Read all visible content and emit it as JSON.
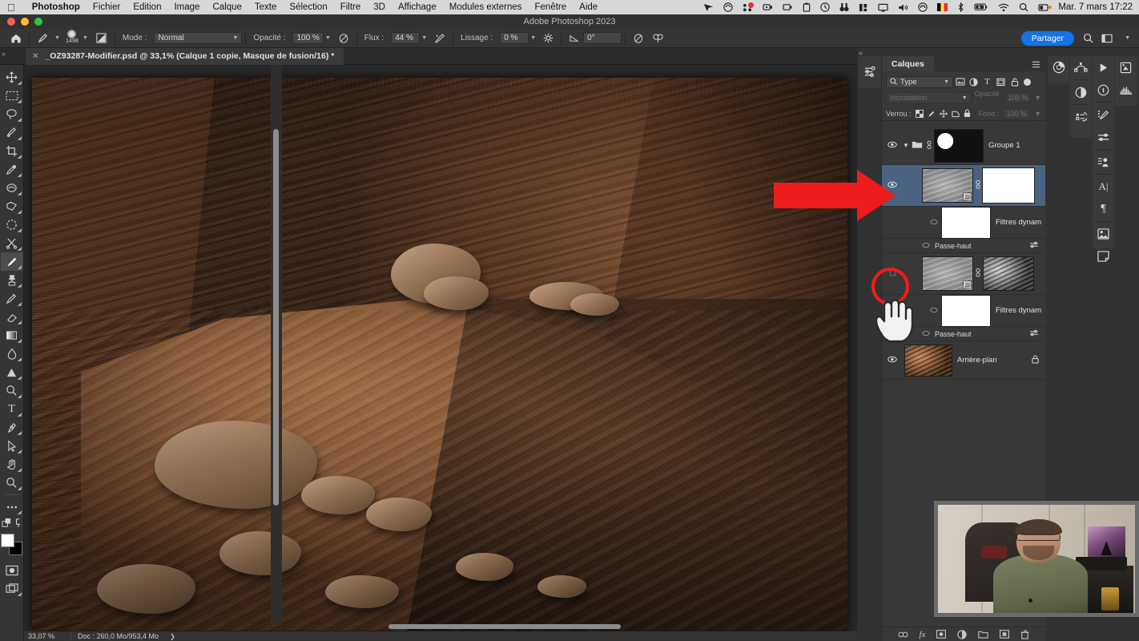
{
  "macos": {
    "apple_icon": "apple-logo",
    "menus": [
      "Photoshop",
      "Fichier",
      "Edition",
      "Image",
      "Calque",
      "Texte",
      "Sélection",
      "Filtre",
      "3D",
      "Affichage",
      "Modules externes",
      "Fenêtre",
      "Aide"
    ],
    "status_icons": [
      "bluejeans-icon",
      "cloud-sync-icon",
      "notifications-icon",
      "screen-record-icon",
      "lock-screen-icon",
      "clipboard-icon",
      "time-machine-icon",
      "search-binoculars-icon",
      "stats-icon",
      "display-icon",
      "volume-icon",
      "siri-icon",
      "keyboard-flag-icon",
      "bluetooth-icon",
      "battery-icon",
      "wifi-icon",
      "spotlight-icon",
      "control-center-icon"
    ],
    "clock": "Mar. 7 mars  17:22"
  },
  "window": {
    "title": "Adobe Photoshop 2023"
  },
  "options_bar": {
    "home_icon": "home-icon",
    "tool_preset_icon": "brush-preset-icon",
    "brush_size": "1498",
    "brush_panel_icon": "brush-settings-icon",
    "mode_label": "Mode :",
    "mode_value": "Normal",
    "opacity_label": "Opacité :",
    "opacity_value": "100 %",
    "opacity_pressure_icon": "pressure-opacity-icon",
    "flow_label": "Flux :",
    "flow_value": "44 %",
    "airbrush_icon": "airbrush-icon",
    "smoothing_label": "Lissage :",
    "smoothing_value": "0 %",
    "smoothing_gear_icon": "gear-icon",
    "angle_icon": "angle-icon",
    "angle_value": "0°",
    "pressure_size_icon": "pressure-size-icon",
    "symmetry_icon": "symmetry-butterfly-icon",
    "share_label": "Partager",
    "search_icon": "search-icon",
    "workspace_icon": "workspace-icon",
    "chevron_icon": "chevron-down-icon"
  },
  "document": {
    "tab_close_icon": "close-icon",
    "tab_title": "_OZ93287-Modifier.psd @ 33,1% (Calque 1 copie, Masque de fusion/16) *",
    "collapse_icon": "collapse-arrows-icon"
  },
  "toolbar": {
    "tools": [
      {
        "name": "move-tool",
        "glyph": "✥",
        "selected": false
      },
      {
        "name": "rectangular-marquee-tool",
        "glyph": "▭",
        "selected": false
      },
      {
        "name": "lasso-tool",
        "glyph": "◯",
        "selected": false
      },
      {
        "name": "object-selection-tool",
        "glyph": "❍",
        "selected": false
      },
      {
        "name": "crop-tool",
        "glyph": "⌗",
        "selected": false
      },
      {
        "name": "eyedropper-tool",
        "glyph": "✒",
        "selected": false
      },
      {
        "name": "spot-healing-brush-tool",
        "glyph": "✿",
        "selected": false
      },
      {
        "name": "patch-tool",
        "glyph": "▰",
        "selected": false
      },
      {
        "name": "frame-tool",
        "glyph": "▣",
        "selected": false
      },
      {
        "name": "scissors-tool",
        "glyph": "✂",
        "selected": false
      },
      {
        "name": "brush-tool",
        "glyph": "🖌",
        "selected": true
      },
      {
        "name": "clone-stamp-tool",
        "glyph": "⚱",
        "selected": false
      },
      {
        "name": "history-brush-tool",
        "glyph": "✎",
        "selected": false
      },
      {
        "name": "eraser-tool",
        "glyph": "◣",
        "selected": false
      },
      {
        "name": "gradient-tool",
        "glyph": "▬",
        "selected": false
      },
      {
        "name": "blur-tool",
        "glyph": "💧",
        "selected": false
      },
      {
        "name": "dodge-tool",
        "glyph": "▲",
        "selected": false
      },
      {
        "name": "zoom-detail-tool",
        "glyph": "🔍",
        "selected": false
      },
      {
        "name": "type-tool",
        "glyph": "T",
        "selected": false
      },
      {
        "name": "pen-tool",
        "glyph": "✑",
        "selected": false
      },
      {
        "name": "path-selection-tool",
        "glyph": "➤",
        "selected": false
      },
      {
        "name": "hand-tool",
        "glyph": "✋",
        "selected": false
      },
      {
        "name": "zoom-tool",
        "glyph": "🔎",
        "selected": false
      },
      {
        "name": "edit-toolbar-tool",
        "glyph": "⋯",
        "selected": false
      }
    ],
    "swap-colors-icon": "swap-colors-icon",
    "default-colors-icon": "default-colors-icon",
    "foreground_color": "#ffffff",
    "background_color": "#000000",
    "quick-mask-icon": "quick-mask-icon",
    "screen-mode-icon": "screen-mode-icon"
  },
  "status": {
    "zoom": "33,07 %",
    "doc_info": "Doc : 260,0 Mo/953,4 Mo",
    "expand_icon": "chevron-right-icon"
  },
  "layers_panel": {
    "tab_label": "Calques",
    "panel_menu_icon": "panel-menu-icon",
    "filter": {
      "search_icon": "search-icon",
      "type_label": "Type",
      "chevron_icon": "chevron-down-icon",
      "filter_icons": [
        "pixel-filter-icon",
        "adjustment-filter-icon",
        "type-filter-icon",
        "shape-filter-icon",
        "smart-object-filter-icon"
      ],
      "toggle_icon": "filter-toggle-icon"
    },
    "blend": {
      "mode_value": "Incrustation",
      "opacity_label": "Opacité :",
      "opacity_value": "100 %",
      "chevron_icon": "chevron-down-icon"
    },
    "lock": {
      "label": "Verrou :",
      "icons": [
        "lock-transparency-icon",
        "lock-image-icon",
        "lock-position-icon",
        "lock-artboard-icon",
        "lock-all-icon"
      ],
      "fill_label": "Fond :",
      "fill_value": "100 %"
    },
    "layers": [
      {
        "name": "Groupe 1",
        "type": "group",
        "visible": true,
        "eye_icon": "eye-icon",
        "twisty_icon": "chevron-down-icon",
        "folder_icon": "folder-icon",
        "link_icon": "link-icon",
        "thumb": "group-mask-thumb",
        "selected": false,
        "locked": false
      },
      {
        "name": "",
        "type": "smart-object",
        "visible": true,
        "eye_icon": "eye-icon",
        "thumb": "gray-texture-thumb",
        "mask_thumb": "white-mask-thumb",
        "link_icon": "mask-link-icon",
        "smart_badge": "smart-object-badge",
        "selected": true,
        "locked": false
      },
      {
        "name": "Filtres dynam",
        "type": "smart-filter-group",
        "visible": false,
        "eye_icon": "eye-off-icon",
        "thumb": "white-filter-mask-thumb",
        "sub_name": "Passe-haut",
        "sub_eye_icon": "eye-off-icon",
        "fx_icon": "filter-options-icon"
      },
      {
        "name": "",
        "type": "smart-object",
        "visible": false,
        "eye_icon": "eye-off-hidden-icon",
        "thumb": "gray-texture-thumb",
        "mask_thumb": "bw-photo-thumb",
        "link_icon": "mask-link-icon",
        "smart_badge": "smart-object-badge",
        "selected": false,
        "locked": false
      },
      {
        "name": "Filtres dynam",
        "type": "smart-filter-group",
        "visible": false,
        "eye_icon": "eye-off-icon",
        "thumb": "white-filter-mask-thumb",
        "sub_name": "Passe-haut",
        "sub_eye_icon": "eye-off-icon",
        "fx_icon": "filter-options-icon"
      },
      {
        "name": "Arrière-plan",
        "type": "background",
        "visible": true,
        "eye_icon": "eye-icon",
        "thumb": "canyon-photo-thumb",
        "selected": false,
        "locked": true,
        "lock_icon": "lock-icon"
      }
    ],
    "bottom_buttons": [
      {
        "name": "link-layers-button",
        "glyph": "∞"
      },
      {
        "name": "layer-style-button",
        "glyph": "fx"
      },
      {
        "name": "add-layer-mask-button",
        "glyph": "▣"
      },
      {
        "name": "new-adjustment-layer-button",
        "glyph": "◐"
      },
      {
        "name": "new-group-button",
        "glyph": "▭"
      },
      {
        "name": "new-layer-button",
        "glyph": "⊞"
      },
      {
        "name": "delete-layer-button",
        "glyph": "🗑"
      }
    ]
  },
  "right_rails": {
    "railA": [
      "color-wheel-icon"
    ],
    "railB": [
      "paths-icon",
      "adjustments-icon",
      "histogram-levels-icon"
    ],
    "railC": [
      "actions-play-icon",
      "info-icon",
      "brush-settings-icon",
      "brush-presets-icon",
      "character-styles-icon",
      "character-icon",
      "paragraph-icon",
      "libraries-icon",
      "notes-icon"
    ],
    "railD": [
      "properties-icon",
      "histogram-icon"
    ]
  },
  "dock": {
    "collapse_icon": "collapse-arrows-icon",
    "adjustments_icon": "adjustments-sliders-icon"
  },
  "annotations": {
    "arrow": {
      "name": "red-arrow-annotation",
      "color": "#ee1c1c",
      "points_to": "selected-layer-row"
    },
    "circle": {
      "name": "red-circle-annotation",
      "color": "#ee1c1c",
      "highlights": "layer-visibility-toggle"
    },
    "cursor": {
      "name": "hand-cursor",
      "type": "pointing-hand"
    }
  },
  "webcam": {
    "name": "webcam-overlay",
    "description": "presenter"
  }
}
